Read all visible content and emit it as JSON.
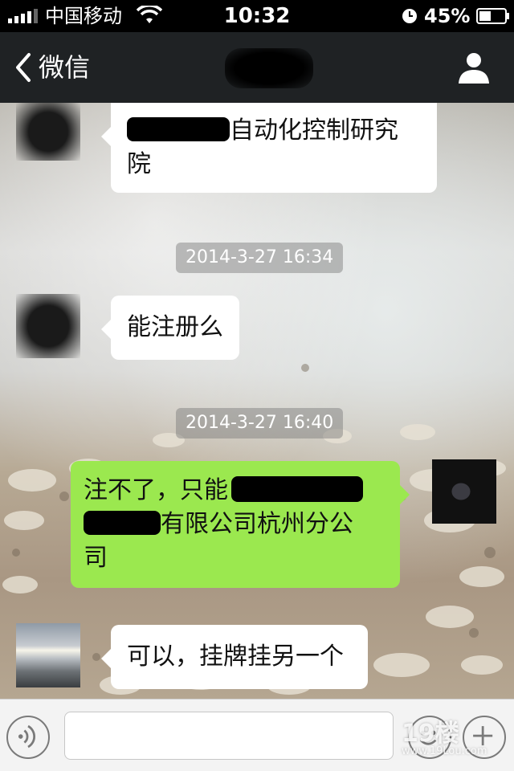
{
  "status_bar": {
    "carrier": "中国移动",
    "time": "10:32",
    "battery_percent": "45%",
    "icons": [
      "signal-icon",
      "wifi-icon",
      "clock-icon",
      "battery-icon"
    ]
  },
  "nav": {
    "back_label": "微信",
    "profile_icon": "person-icon"
  },
  "messages": [
    {
      "side": "left",
      "avatar": "redacted",
      "text_visible": "自动化控制研究院",
      "line1_text": "自动化控制研究",
      "line2_text": "院"
    },
    {
      "timestamp": "2014-3-27 16:34"
    },
    {
      "side": "left",
      "avatar": "redacted",
      "text": "能注册么"
    },
    {
      "timestamp": "2014-3-27 16:40"
    },
    {
      "side": "right",
      "avatar": "self",
      "line1_text": "注不了，只能",
      "line2_text": "有限公司杭州分公",
      "line3_text": "司"
    },
    {
      "side": "left",
      "avatar": "landscape",
      "text": "可以，挂牌挂另一个"
    }
  ],
  "input_bar": {
    "text_value": "",
    "icons": [
      "voice-icon",
      "emoji-icon",
      "plus-icon"
    ]
  },
  "watermark": {
    "text": "19楼",
    "sub": "www.19Lou.com"
  },
  "colors": {
    "status_bg": "#000000",
    "nav_bg": "#1f2224",
    "bubble_left": "#ffffff",
    "bubble_right": "#9be84f",
    "timestamp_bg": "rgba(120,120,120,0.45)"
  }
}
